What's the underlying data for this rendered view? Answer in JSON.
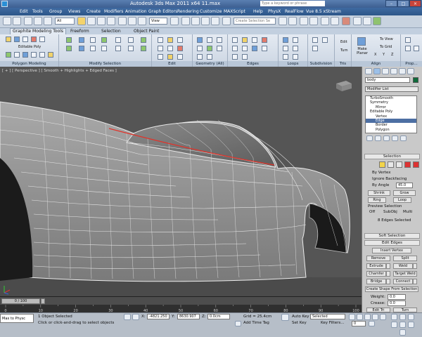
{
  "window": {
    "title": "Autodesk 3ds Max  2011 x64      11.max",
    "search_placeholder": "Type a keyword or phrase"
  },
  "menu": [
    "Edit",
    "Tools",
    "Group",
    "Views",
    "Create",
    "Modifiers",
    "Animation",
    "Graph Editors",
    "Rendering",
    "Customize",
    "MAXScript",
    "Help",
    "PhysX",
    "RealFlow",
    "Vue 8.5 xStream"
  ],
  "quick_access": {
    "selection_set_placeholder": "Create Selection Se",
    "view_combo": "View",
    "filter_combo": "All"
  },
  "ribbon_tabs": [
    "Graphite Modeling Tools",
    "Freeform",
    "Selection",
    "Object Paint"
  ],
  "ribbon": {
    "polygon_modeling": {
      "label": "Polygon Modeling",
      "object": "Editable Poly"
    },
    "modify_selection": {
      "label": "Modify Selection"
    },
    "edit": {
      "label": "Edit"
    },
    "geometry": {
      "label": "Geometry (All)"
    },
    "edges": {
      "label": "Edges"
    },
    "loops": {
      "label": "Loops"
    },
    "subdivision": {
      "label": "Subdivision"
    },
    "tris": {
      "label": "Tris",
      "edit": "Edit",
      "turn": "Turn"
    },
    "align": {
      "label": "Align",
      "make_planar": "Make Planar",
      "to_view": "To View",
      "to_grid": "To Grid",
      "x": "X",
      "y": "Y",
      "z": "Z"
    },
    "properties": {
      "label": "Prop..."
    }
  },
  "viewport": {
    "label": "[ + ] [ Perspective ] [ Smooth + Highlights + Edged Faces ]"
  },
  "command_panel": {
    "object_name": "body",
    "modifier_list": "Modifier List",
    "stack": [
      "TurboSmooth",
      "Symmetry",
      "Mirror",
      "Editable Poly",
      "Vertex",
      "Edge",
      "Border",
      "Polygon"
    ],
    "selection": {
      "header": "Selection",
      "by_vertex": "By Vertex",
      "ignore_backfacing": "Ignore Backfacing",
      "by_angle": "By Angle",
      "by_angle_value": "45.0",
      "shrink": "Shrink",
      "grow": "Grow",
      "ring": "Ring",
      "loop": "Loop",
      "preview_selection": "Preview Selection",
      "off": "Off",
      "subobj": "SubObj",
      "multi": "Multi",
      "status": "8 Edges Selected"
    },
    "soft_selection": "Soft Selection",
    "edit_edges": {
      "header": "Edit Edges",
      "insert_vertex": "Insert Vertex",
      "remove": "Remove",
      "split": "Split",
      "extrude": "Extrude",
      "weld": "Weld",
      "chamfer": "Chamfer",
      "target_weld": "Target Weld",
      "bridge": "Bridge",
      "connect": "Connect",
      "create_shape": "Create Shape From Selection",
      "weight_label": "Weight:",
      "weight_value": "0.0",
      "crease_label": "Crease:",
      "crease_value": "0.0",
      "edit_tri": "Edit Tri",
      "turn": "Turn"
    }
  },
  "timeline": {
    "slider": "0 / 100",
    "ticks": [
      "0",
      "10",
      "20",
      "30",
      "40",
      "50",
      "60",
      "70",
      "80",
      "90",
      "100"
    ]
  },
  "statusbar": {
    "listener": "Max to Physc",
    "selected": "1 Object Selected",
    "prompt": "Click or click-and-drag to select objects",
    "x_label": "X:",
    "x_value": "-4821.250",
    "y_label": "Y:",
    "y_value": "8630.907",
    "z_label": "Z:",
    "z_value": "0.0cm",
    "grid": "Grid = 25.4cm",
    "add_time_tag": "Add Time Tag",
    "auto_key": "Auto Key",
    "set_key": "Set Key",
    "selected_combo": "Selected",
    "key_filters": "Key Filters...",
    "frame": "0"
  }
}
